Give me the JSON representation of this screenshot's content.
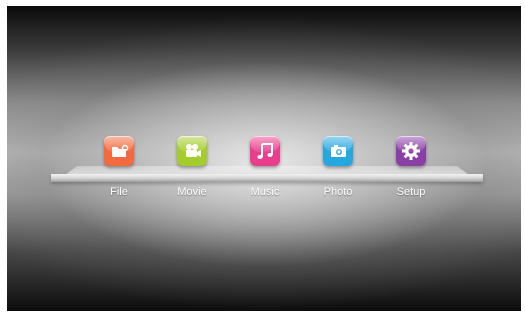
{
  "menu": {
    "items": [
      {
        "label": "File",
        "icon": "folder-icon",
        "color": "#f26a3d"
      },
      {
        "label": "Movie",
        "icon": "camera-icon",
        "color": "#a4cc2c"
      },
      {
        "label": "Music",
        "icon": "music-note-icon",
        "color": "#e83f8c"
      },
      {
        "label": "Photo",
        "icon": "photo-camera-icon",
        "color": "#25a7e0"
      },
      {
        "label": "Setup",
        "icon": "gear-icon",
        "color": "#8a3fa6"
      }
    ]
  }
}
